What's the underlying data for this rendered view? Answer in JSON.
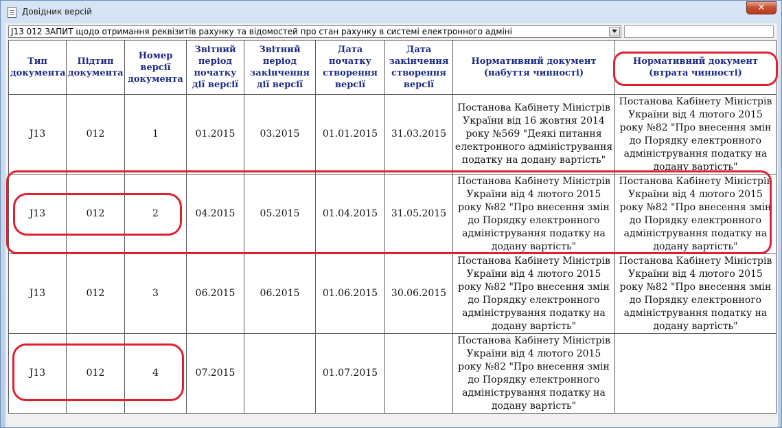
{
  "window": {
    "title": "Довідник версій",
    "close_symbol": "✕"
  },
  "combo": {
    "value": "J13 012 ЗАПИТ щодо отримання реквізитів рахунку та відомостей про стан рахунку в системі електронного адміні"
  },
  "table": {
    "headers": [
      "Тип документа",
      "Підтип документа",
      "Номер версії документа",
      "Звітний період початку дії версії",
      "Звітний період закінчення дії версії",
      "Дата початку створення версії",
      "Дата закінчення створення версії",
      "Нормативний документ (набуття чинності)",
      "Нормативний документ (втрата чинності)"
    ],
    "rows": [
      {
        "type": "J13",
        "subtype": "012",
        "version": "1",
        "period_start": "01.2015",
        "period_end": "03.2015",
        "date_start": "01.01.2015",
        "date_end": "31.03.2015",
        "doc_in": "Постанова Кабінету Міністрів України від 16 жовтня 2014 року №569 \"Деякі питання електронного адміністрування податку на додану вартість\"",
        "doc_out": "Постанова Кабінету Міністрів України від 4 лютого 2015 року №82 \"Про внесення змін до Порядку електронного адміністрування податку на додану вартість\""
      },
      {
        "type": "J13",
        "subtype": "012",
        "version": "2",
        "period_start": "04.2015",
        "period_end": "05.2015",
        "date_start": "01.04.2015",
        "date_end": "31.05.2015",
        "doc_in": "Постанова Кабінету Міністрів України від 4 лютого 2015 року №82 \"Про внесення змін до Порядку електронного адміністрування податку на додану вартість\"",
        "doc_out": "Постанова Кабінету Міністрів України від 4 лютого 2015 року №82 \"Про внесення змін до Порядку електронного адміністрування податку на додану вартість\""
      },
      {
        "type": "J13",
        "subtype": "012",
        "version": "3",
        "period_start": "06.2015",
        "period_end": "06.2015",
        "date_start": "01.06.2015",
        "date_end": "30.06.2015",
        "doc_in": "Постанова Кабінету Міністрів України від 4 лютого 2015 року №82 \"Про внесення змін до Порядку електронного адміністрування податку на додану вартість\"",
        "doc_out": "Постанова Кабінету Міністрів України від 4 лютого 2015 року №82 \"Про внесення змін до Порядку електронного адміністрування податку на додану вартість\""
      },
      {
        "type": "J13",
        "subtype": "012",
        "version": "4",
        "period_start": "07.2015",
        "period_end": "",
        "date_start": "01.07.2015",
        "date_end": "",
        "doc_in": "Постанова Кабінету Міністрів України від 4 лютого 2015 року №82 \"Про внесення змін до Порядку електронного адміністрування податку на додану вартість\"",
        "doc_out": ""
      }
    ]
  },
  "colors": {
    "header_text": "#1c2a84",
    "annotation": "#e02030",
    "close_button": "#c75030"
  }
}
